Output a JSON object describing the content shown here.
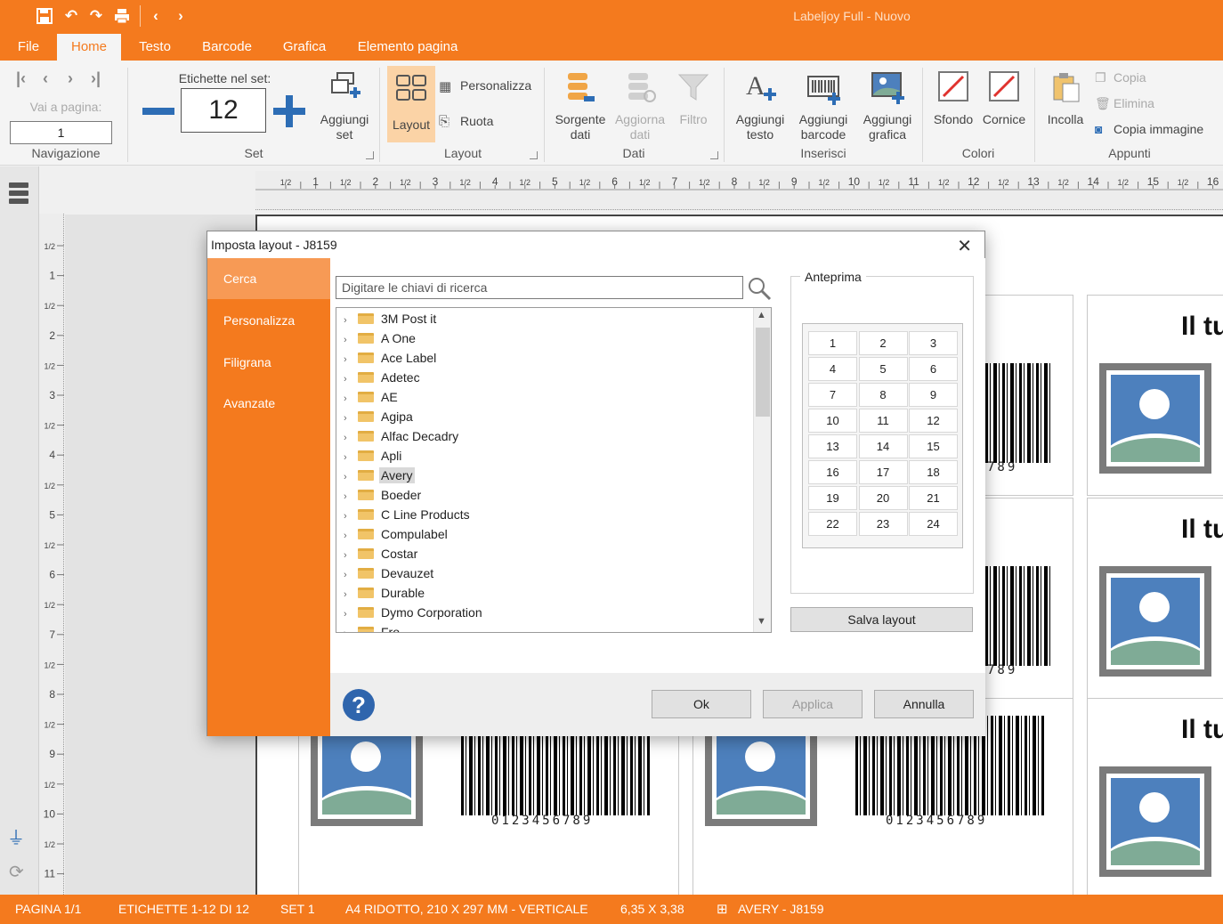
{
  "app": {
    "title": "Labeljoy Full - Nuovo"
  },
  "quick_access": [
    "save-icon",
    "undo-icon",
    "redo-icon",
    "print-icon",
    "back-icon",
    "forward-icon"
  ],
  "menu_tabs": [
    "File",
    "Home",
    "Testo",
    "Barcode",
    "Grafica",
    "Elemento pagina"
  ],
  "active_tab": "Home",
  "ribbon": {
    "navigation": {
      "goto_label": "Vai a pagina:",
      "page_value": "1",
      "group": "Navigazione"
    },
    "set": {
      "count_label": "Etichette nel set:",
      "count_value": "12",
      "add_set_1": "Aggiungi",
      "add_set_2": "set",
      "group": "Set"
    },
    "layout": {
      "layout_label": "Layout",
      "customize_label": "Personalizza",
      "rotate_label": "Ruota",
      "group": "Layout"
    },
    "data": {
      "source_1": "Sorgente",
      "source_2": "dati",
      "update_1": "Aggiorna",
      "update_2": "dati",
      "filter": "Filtro",
      "group": "Dati"
    },
    "insert": {
      "text_1": "Aggiungi",
      "text_2": "testo",
      "barcode_1": "Aggiungi",
      "barcode_2": "barcode",
      "graphic_1": "Aggiungi",
      "graphic_2": "grafica",
      "group": "Inserisci"
    },
    "colors": {
      "background": "Sfondo",
      "frame": "Cornice",
      "group": "Colori"
    },
    "clipboard": {
      "paste": "Incolla",
      "copy": "Copia",
      "delete": "Elimina",
      "copy_image": "Copia immagine",
      "group": "Appunti"
    }
  },
  "rulers": {
    "h_ticks": [
      "1/2",
      "1",
      "1/2",
      "2",
      "1/2",
      "3",
      "1/2",
      "4",
      "1/2",
      "5",
      "1/2",
      "6",
      "1/2",
      "7",
      "1/2",
      "8",
      "1/2",
      "9",
      "1/2",
      "10",
      "1/2",
      "11",
      "1/2",
      "12",
      "1/2",
      "13",
      "1/2",
      "14",
      "1/2",
      "15",
      "1/2",
      "16"
    ],
    "v_ticks": [
      "1/2",
      "1",
      "1/2",
      "2",
      "1/2",
      "3",
      "1/2",
      "4",
      "1/2",
      "5",
      "1/2",
      "6",
      "1/2",
      "7",
      "1/2",
      "8",
      "1/2",
      "9",
      "1/2",
      "10",
      "1/2",
      "11"
    ]
  },
  "labels": {
    "text": "Il tuo testo qui",
    "barcode_number": "0123456789"
  },
  "dialog": {
    "title": "Imposta layout - J8159",
    "sidebar": [
      "Cerca",
      "Personalizza",
      "Filigrana",
      "Avanzate"
    ],
    "active_side": "Cerca",
    "search_placeholder": "Digitare le chiavi di ricerca",
    "tree_items": [
      "3M Post it",
      "A One",
      "Ace Label",
      "Adetec",
      "AE",
      "Agipa",
      "Alfac Decadry",
      "Apli",
      "Avery",
      "Boeder",
      "C Line Products",
      "Compulabel",
      "Costar",
      "Devauzet",
      "Durable",
      "Dymo Corporation",
      "Fro"
    ],
    "selected_item": "Avery",
    "preview_title": "Anteprima",
    "preview_cells": [
      "1",
      "2",
      "3",
      "4",
      "5",
      "6",
      "7",
      "8",
      "9",
      "10",
      "11",
      "12",
      "13",
      "14",
      "15",
      "16",
      "17",
      "18",
      "19",
      "20",
      "21",
      "22",
      "23",
      "24"
    ],
    "save_layout": "Salva layout",
    "ok": "Ok",
    "apply": "Applica",
    "cancel": "Annulla"
  },
  "status_bar": {
    "page": "PAGINA 1/1",
    "labels": "ETICHETTE 1-12 DI 12",
    "set": "SET 1",
    "paper": "A4 RIDOTTO, 210 X 297 MM - VERTICALE",
    "size": "6,35 X 3,38",
    "layout": "AVERY - J8159"
  },
  "colors": {
    "accent": "#f47a1e",
    "blue": "#2d6db5"
  }
}
